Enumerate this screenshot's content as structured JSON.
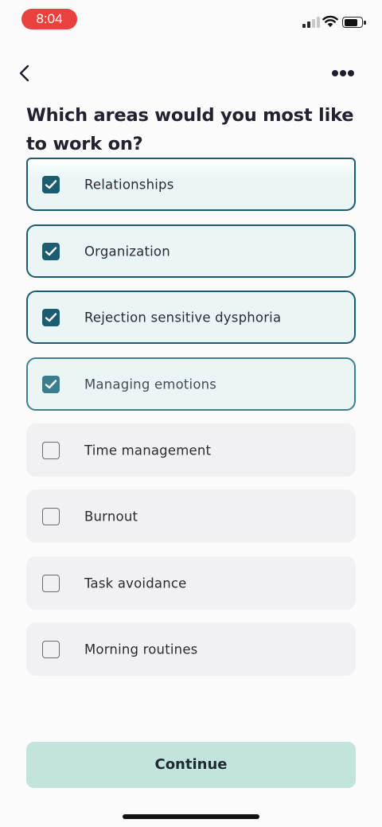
{
  "status_bar": {
    "time": "8:04",
    "time_pill_color": "#e8413e",
    "icons": [
      "cellular-signal-icon",
      "wifi-icon",
      "battery-icon"
    ],
    "battery_level": 0.8
  },
  "nav": {
    "back_icon": "chevron-left-icon",
    "more_icon": "more-horizontal-icon"
  },
  "title": "Which areas would you most like to work on?",
  "options": [
    {
      "label": "Relationships",
      "checked": true
    },
    {
      "label": "Organization",
      "checked": true
    },
    {
      "label": "Rejection sensitive dysphoria",
      "checked": true
    },
    {
      "label": "Managing emotions",
      "checked": true
    },
    {
      "label": "Time management",
      "checked": false
    },
    {
      "label": "Burnout",
      "checked": false
    },
    {
      "label": "Task avoidance",
      "checked": false
    },
    {
      "label": "Morning routines",
      "checked": false
    }
  ],
  "continue_label": "Continue",
  "colors": {
    "accent": "#1b5c70",
    "selected_bg": "#eaf6f6",
    "unselected_bg": "#f1f0f3",
    "continue_bg": "#c1e4dd"
  }
}
